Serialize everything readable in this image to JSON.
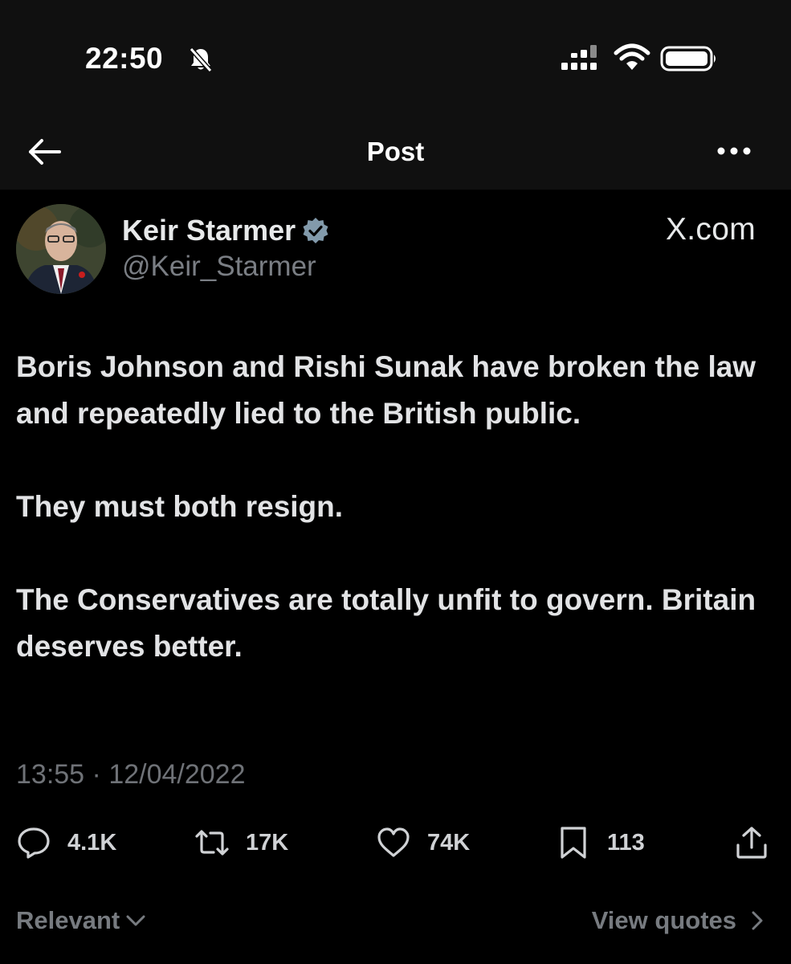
{
  "status_bar": {
    "time": "22:50",
    "bell_icon": "bell-slash-icon",
    "signal_icon": "cellular-signal-icon",
    "wifi_icon": "wifi-icon",
    "battery_icon": "battery-icon"
  },
  "nav": {
    "back_icon": "arrow-left-icon",
    "title": "Post",
    "more_icon": "ellipsis-icon"
  },
  "author": {
    "display_name": "Keir Starmer",
    "handle": "@Keir_Starmer",
    "verified_icon": "verified-badge-icon",
    "verified_color": "#829aab"
  },
  "source_label": "X.com",
  "post": {
    "paragraphs": [
      "Boris Johnson and Rishi Sunak have broken the law and repeatedly lied to the British public.",
      "They must both resign.",
      "The Conservatives are totally unfit to govern. Britain deserves better."
    ],
    "time": "13:55",
    "separator": "·",
    "date": "12/04/2022"
  },
  "actions": {
    "replies": {
      "icon": "reply-icon",
      "count": "4.1K"
    },
    "reposts": {
      "icon": "repost-icon",
      "count": "17K"
    },
    "likes": {
      "icon": "heart-icon",
      "count": "74K"
    },
    "bookmarks": {
      "icon": "bookmark-icon",
      "count": "113"
    },
    "share": {
      "icon": "share-icon"
    }
  },
  "footer": {
    "sort_label": "Relevant",
    "sort_icon": "chevron-down-icon",
    "view_quotes_label": "View quotes",
    "view_quotes_icon": "chevron-right-icon"
  },
  "colors": {
    "background": "#000000",
    "header_background": "#101010",
    "text_primary": "#e7e9ea",
    "text_secondary": "#71767b"
  }
}
